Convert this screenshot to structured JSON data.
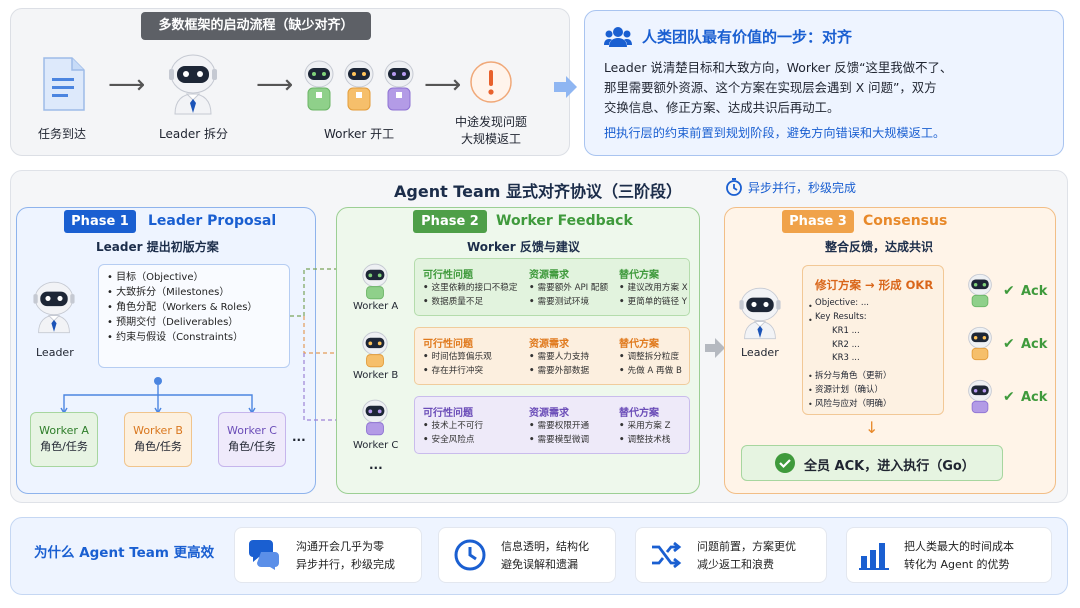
{
  "top": {
    "banner": "多数框架的启动流程（缺少对齐）",
    "steps": [
      "任务到达",
      "Leader 拆分",
      "Worker 开工"
    ],
    "problem": [
      "中途发现问题",
      "大规模返工"
    ]
  },
  "alignment": {
    "title": "人类团队最有价值的一步：对齐",
    "body": [
      "Leader 说清楚目标和大致方向，Worker 反馈“这里我做不了、",
      "那里需要额外资源、这个方案在实现层会遇到 X 问题”，双方",
      "交换信息、修正方案、达成共识后再动工。"
    ],
    "highlight": "把执行层的约束前置到规划阶段，避免方向错误和大规模返工。"
  },
  "protocol": {
    "title": "Agent Team 显式对齐协议（三阶段）",
    "async_note": "异步并行，秒级完成"
  },
  "phase1": {
    "tag": "Phase 1",
    "name": "Leader Proposal",
    "subtitle": "Leader 提出初版方案",
    "leader": "Leader",
    "items": [
      "目标（Objective）",
      "大致拆分（Milestones）",
      "角色分配（Workers & Roles）",
      "预期交付（Deliverables）",
      "约束与假设（Constraints）"
    ],
    "workers": [
      {
        "name": "Worker A",
        "role": "角色/任务"
      },
      {
        "name": "Worker B",
        "role": "角色/任务"
      },
      {
        "name": "Worker C",
        "role": "角色/任务"
      }
    ],
    "more": "..."
  },
  "phase2": {
    "tag": "Phase 2",
    "name": "Worker Feedback",
    "subtitle": "Worker 反馈与建议",
    "headers": [
      "可行性问题",
      "资源需求",
      "替代方案"
    ],
    "workers": [
      {
        "name": "Worker A",
        "cols": [
          [
            "这里依赖的接口不稳定",
            "数据质量不足"
          ],
          [
            "需要额外 API 配额",
            "需要测试环境"
          ],
          [
            "建议改用方案 X",
            "更简单的链径 Y"
          ]
        ]
      },
      {
        "name": "Worker B",
        "cols": [
          [
            "时间估算偏乐观",
            "存在并行冲突"
          ],
          [
            "需要人力支持",
            "需要外部数据"
          ],
          [
            "调整拆分粒度",
            "先做 A 再做 B"
          ]
        ]
      },
      {
        "name": "Worker C",
        "cols": [
          [
            "技术上不可行",
            "安全风险点"
          ],
          [
            "需要权限开通",
            "需要模型微调"
          ],
          [
            "采用方案 Z",
            "调整技术栈"
          ]
        ]
      }
    ],
    "more": "..."
  },
  "phase3": {
    "tag": "Phase 3",
    "name": "Consensus",
    "subtitle": "整合反馈，达成共识",
    "leader": "Leader",
    "okr_title": "修订方案 → 形成 OKR",
    "okr_lines": [
      "Objective: ...",
      "Key Results:",
      "KR1 ...",
      "KR2 ...",
      "KR3 ..."
    ],
    "okr_bullets": [
      "拆分与角色（更新）",
      "资源计划（确认）",
      "风险与应对（明确）"
    ],
    "ack": "Ack",
    "final": "全员 ACK，进入执行（Go）"
  },
  "why": {
    "title": "为什么 Agent Team 更高效",
    "cards": [
      {
        "icon": "chat-icon",
        "lines": [
          "沟通开会几乎为零",
          "异步并行，秒级完成"
        ]
      },
      {
        "icon": "clock-icon",
        "lines": [
          "信息透明，结构化",
          "避免误解和遗漏"
        ]
      },
      {
        "icon": "shuffle-icon",
        "lines": [
          "问题前置，方案更优",
          "减少返工和浪费"
        ]
      },
      {
        "icon": "bar-chart-icon",
        "lines": [
          "把人类最大的时间成本",
          "转化为 Agent 的优势"
        ]
      }
    ]
  },
  "colors": {
    "blue": "#1a5fd1",
    "green": "#3f9a3c",
    "orange": "#e8892a",
    "purple": "#7a5bc4"
  }
}
